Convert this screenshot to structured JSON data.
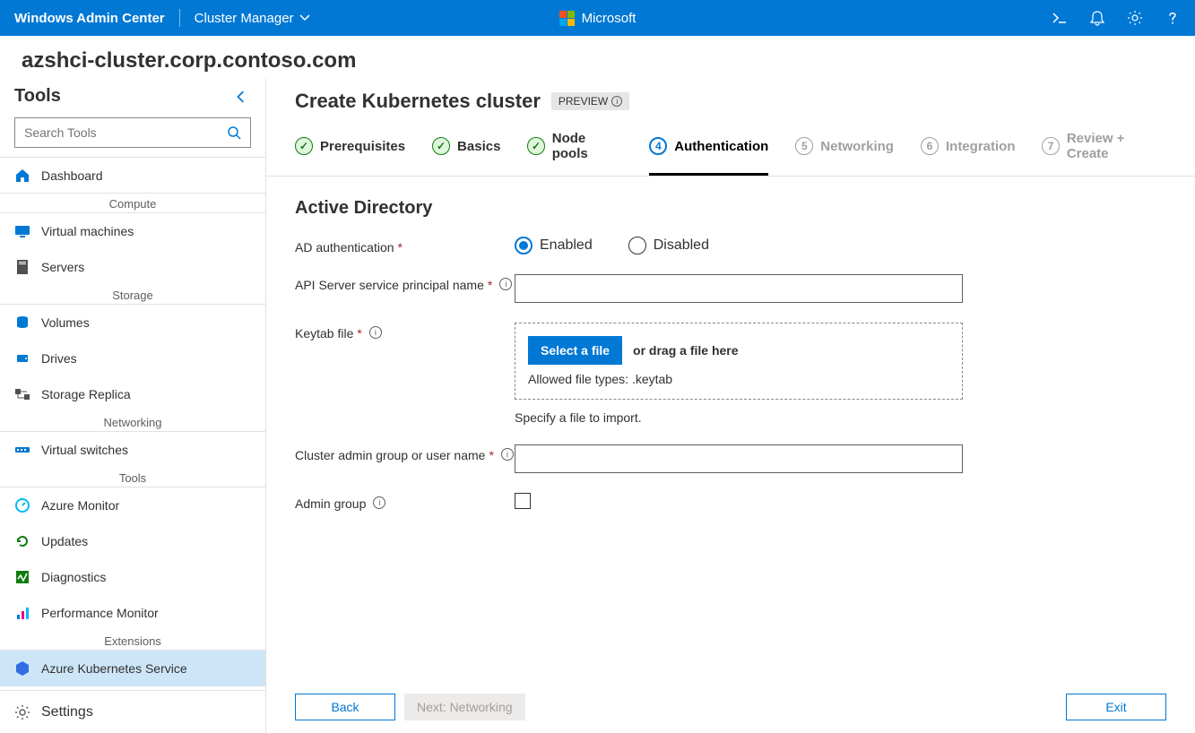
{
  "topbar": {
    "app_title": "Windows Admin Center",
    "context": "Cluster Manager",
    "brand": "Microsoft"
  },
  "page": {
    "cluster_fqdn": "azshci-cluster.corp.contoso.com"
  },
  "tools": {
    "heading": "Tools",
    "search_placeholder": "Search Tools",
    "dashboard": "Dashboard",
    "sections": {
      "compute": "Compute",
      "storage": "Storage",
      "networking": "Networking",
      "tools": "Tools",
      "extensions": "Extensions"
    },
    "items": {
      "virtual_machines": "Virtual machines",
      "servers": "Servers",
      "volumes": "Volumes",
      "drives": "Drives",
      "storage_replica": "Storage Replica",
      "virtual_switches": "Virtual switches",
      "azure_monitor": "Azure Monitor",
      "updates": "Updates",
      "diagnostics": "Diagnostics",
      "performance_monitor": "Performance Monitor",
      "aks": "Azure Kubernetes Service"
    },
    "settings": "Settings"
  },
  "wizard": {
    "title": "Create Kubernetes cluster",
    "preview_label": "PREVIEW",
    "steps": {
      "prerequisites": "Prerequisites",
      "basics": "Basics",
      "node_pools": "Node pools",
      "authentication": "Authentication",
      "networking": "Networking",
      "integration": "Integration",
      "review": "Review + Create",
      "n5": "5",
      "n6": "6",
      "n7": "7",
      "n4": "4"
    }
  },
  "form": {
    "section_title": "Active Directory",
    "labels": {
      "ad_auth": "AD authentication",
      "api_spn": "API Server service principal name",
      "keytab": "Keytab file",
      "cluster_admin": "Cluster admin group or user name",
      "admin_group": "Admin group"
    },
    "radio": {
      "enabled": "Enabled",
      "disabled": "Disabled"
    },
    "dropzone": {
      "button": "Select a file",
      "drag_text": "or drag a file here",
      "allowed": "Allowed file types: .keytab",
      "specify": "Specify a file to import."
    }
  },
  "footer": {
    "back": "Back",
    "next": "Next: Networking",
    "exit": "Exit"
  }
}
